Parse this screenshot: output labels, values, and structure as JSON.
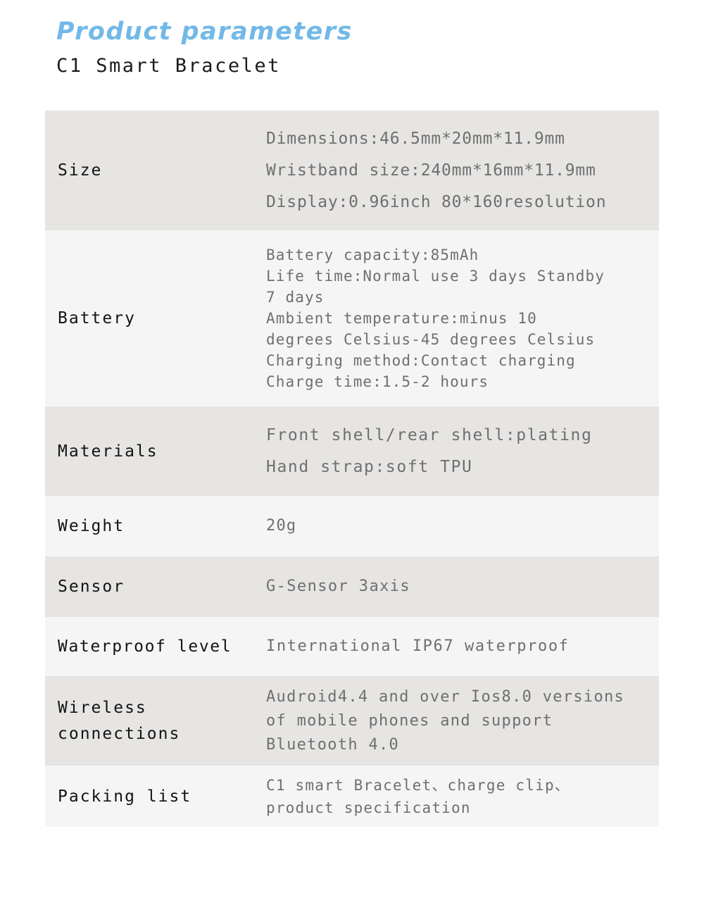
{
  "heading": {
    "title": "Product parameters",
    "subtitle": "C1 Smart Bracelet",
    "title_color": "#72b9e8",
    "subtitle_color": "#1c1c1c"
  },
  "colors": {
    "row_shade_dark": "#e6e5e3",
    "row_shade_light": "#f5f5f5",
    "label_text": "#131313",
    "value_text": "#6f6f6f",
    "page_background": "#ffffff"
  },
  "spec_table": {
    "rows": [
      {
        "label": "Size",
        "value": "Dimensions:46.5mm*20mm*11.9mm\nWristband size:240mm*16mm*11.9mm\nDisplay:0.96inch 80*160resolution"
      },
      {
        "label": "Battery",
        "value": "Battery capacity:85mAh\nLife time:Normal use 3 days Standby\n7 days\nAmbient temperature:minus 10\ndegrees Celsius-45 degrees Celsius\nCharging method:Contact charging\nCharge time:1.5-2 hours"
      },
      {
        "label": "Materials",
        "value": "Front shell/rear shell:plating\nHand strap:soft TPU"
      },
      {
        "label": "Weight",
        "value": "20g"
      },
      {
        "label": "Sensor",
        "value": "G-Sensor 3axis"
      },
      {
        "label": "Waterproof level",
        "value": "International IP67 waterproof"
      },
      {
        "label": "Wireless\nconnections",
        "value": "Audroid4.4 and over Ios8.0 versions\nof mobile phones and support\nBluetooth 4.0"
      },
      {
        "label": "Packing list",
        "value": "C1 smart Bracelet、charge clip、\nproduct specification"
      }
    ]
  }
}
